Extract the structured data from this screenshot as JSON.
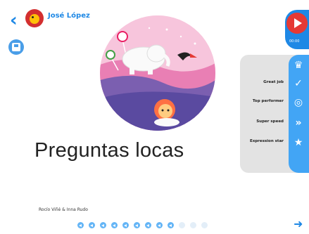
{
  "header": {
    "user_name": "José López"
  },
  "book": {
    "title": "Preguntas locas",
    "authors": "Rocío Viñé & Inna Rudo"
  },
  "player": {
    "time": "00:00"
  },
  "badges": [
    {
      "label": "Great job",
      "icon": "check-icon"
    },
    {
      "label": "Top performer",
      "icon": "target-icon"
    },
    {
      "label": "Super speed",
      "icon": "double-chevron-icon"
    },
    {
      "label": "Expression star",
      "icon": "star-icon"
    }
  ],
  "pages": {
    "total": 12,
    "visited": 9
  },
  "colors": {
    "accent": "#1e88e5",
    "play": "#e53935",
    "rail": "#42a5f5"
  }
}
